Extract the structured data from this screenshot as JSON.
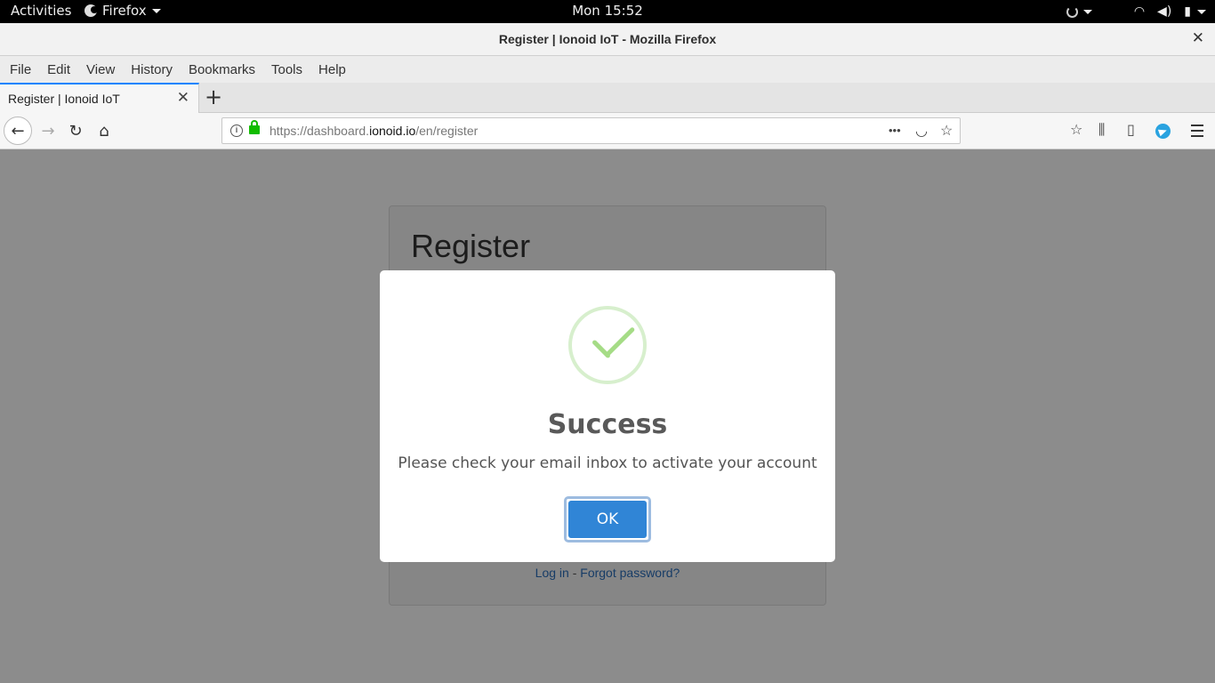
{
  "system": {
    "activities": "Activities",
    "app_name": "Firefox",
    "clock": "Mon 15:52"
  },
  "window": {
    "title": "Register | Ionoid IoT - Mozilla Firefox",
    "close": "✕"
  },
  "menubar": {
    "items": [
      {
        "label": "File"
      },
      {
        "label": "Edit"
      },
      {
        "label": "View"
      },
      {
        "label": "History"
      },
      {
        "label": "Bookmarks"
      },
      {
        "label": "Tools"
      },
      {
        "label": "Help"
      }
    ]
  },
  "tabs": [
    {
      "label": "Register | Ionoid IoT",
      "active": true
    }
  ],
  "tab_close": "✕",
  "new_tab": "+",
  "url": {
    "prefix": "https://dashboard.",
    "domain": "ionoid.io",
    "path": "/en/register",
    "more": "•••"
  },
  "page": {
    "card_title": "Register",
    "links": {
      "login": "Log in",
      "separator": " - ",
      "forgot": "Forgot password?"
    }
  },
  "modal": {
    "title": "Success",
    "text": "Please check your email inbox to activate your account",
    "ok_label": "OK"
  },
  "colors": {
    "accent": "#3085d6",
    "success": "#a5dc86",
    "tab_highlight": "#0a84ff"
  }
}
